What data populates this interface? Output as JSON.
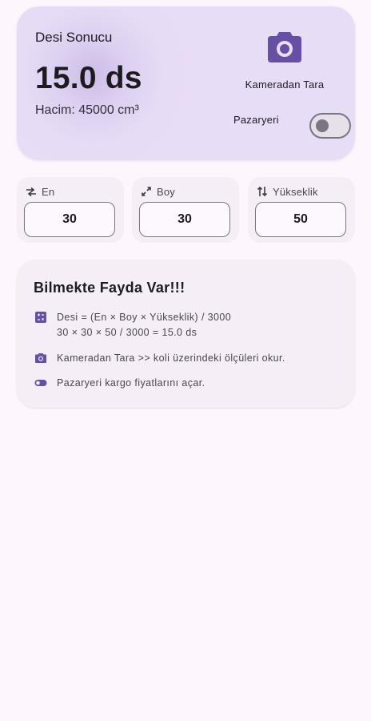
{
  "result": {
    "title": "Desi Sonucu",
    "value": "15.0 ds",
    "volume": "Hacim: 45000 cm³",
    "camera_label": "Kameradan Tara",
    "marketplace_label": "Pazaryeri",
    "marketplace_on": false
  },
  "dimensions": [
    {
      "label": "En",
      "value": "30",
      "icon": "swap-horiz-icon"
    },
    {
      "label": "Boy",
      "value": "30",
      "icon": "diagonal-arrows-icon"
    },
    {
      "label": "Yükseklik",
      "value": "50",
      "icon": "swap-vert-icon"
    }
  ],
  "info": {
    "title": "Bilmekte Fayda Var!!!",
    "formula_line1": "Desi = (En × Boy × Yükseklik) / 3000",
    "formula_line2": "30 × 30 × 50 / 3000 = 15.0 ds",
    "camera_tip": "Kameradan Tara >> koli üzerindeki ölçüleri okur.",
    "market_tip": "Pazaryeri kargo fiyatlarını açar."
  },
  "colors": {
    "accent": "#6750a4",
    "card": "#e8ddf6",
    "background": "#fdf7fd"
  }
}
